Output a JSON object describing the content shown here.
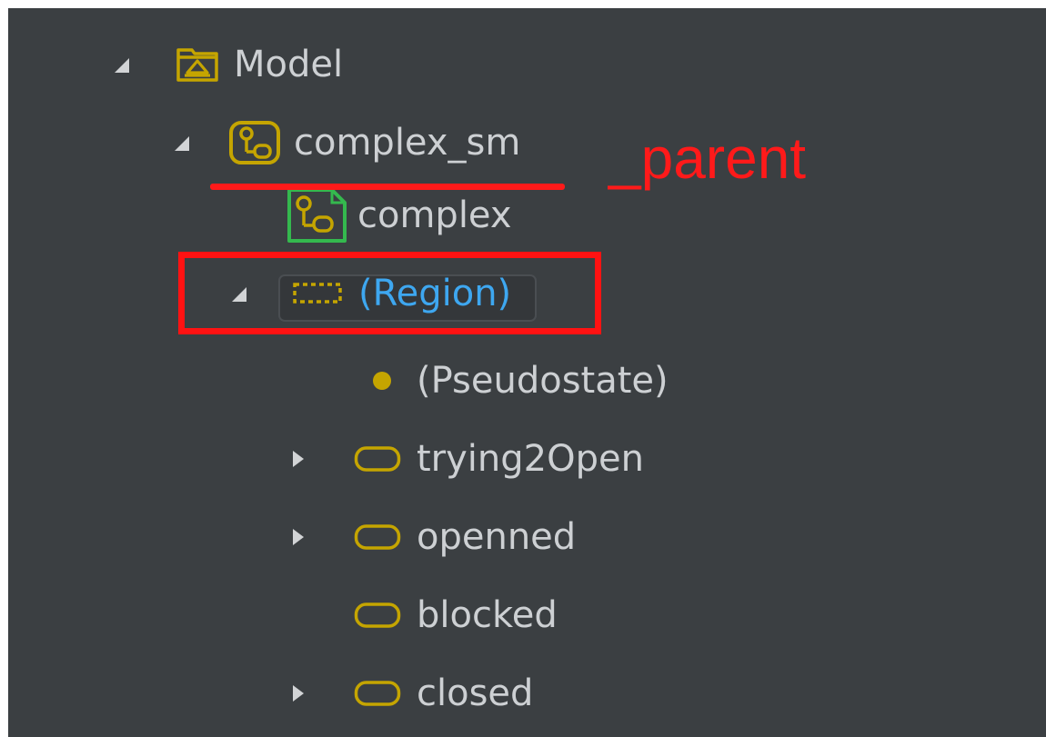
{
  "tree": {
    "model": {
      "label": "Model",
      "icon": "package-icon"
    },
    "complex_sm": {
      "label": "complex_sm",
      "icon": "state-machine-icon"
    },
    "complex": {
      "label": "complex",
      "icon": "state-machine-diagram-icon"
    },
    "region": {
      "label": "(Region)",
      "icon": "region-icon"
    },
    "pseudostate": {
      "label": "(Pseudostate)",
      "icon": "pseudostate-dot-icon"
    },
    "states": [
      {
        "label": "trying2Open",
        "icon": "state-icon"
      },
      {
        "label": "openned",
        "icon": "state-icon"
      },
      {
        "label": "blocked",
        "icon": "state-icon"
      },
      {
        "label": "closed",
        "icon": "state-icon"
      }
    ]
  },
  "annotation": {
    "text": "_parent"
  },
  "colors": {
    "panel_bg": "#3b3f42",
    "text": "#cdd0d3",
    "region_text": "#3ea7f0",
    "icon_yellow": "#c5a500",
    "icon_green": "#34b94e",
    "annotation_red": "#ff1a1a"
  }
}
